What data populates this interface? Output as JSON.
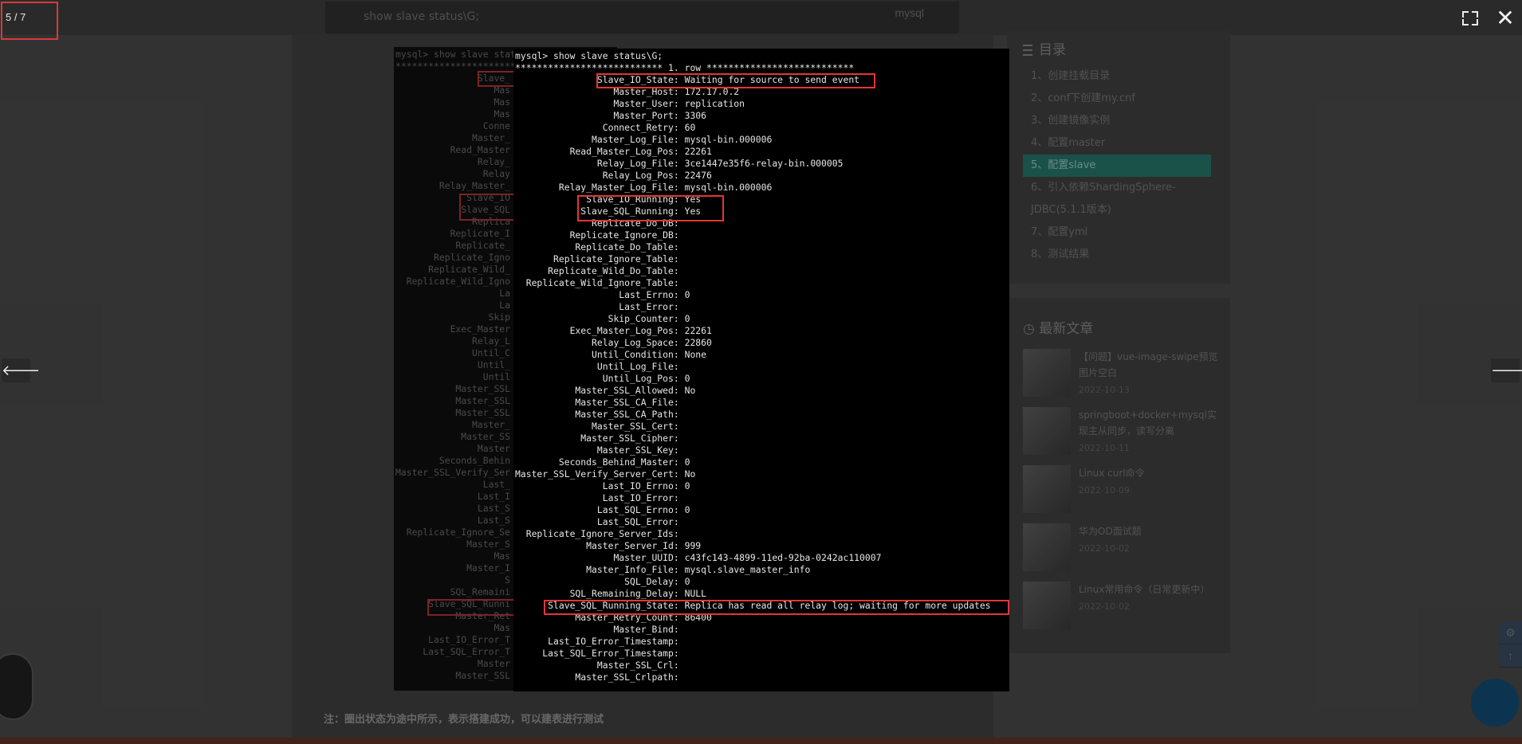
{
  "viewer": {
    "counter": "5 / 7",
    "close_label": "✕",
    "prev_label": "🡐",
    "next_label": "🡒"
  },
  "search": {
    "text": "show slave status\\G;",
    "tag": "mysql"
  },
  "toc": {
    "title": "目录",
    "items": [
      {
        "label": "1、创建挂载目录"
      },
      {
        "label": "2、conf下创建my.cnf"
      },
      {
        "label": "3、创建镜像实例"
      },
      {
        "label": "4、配置master"
      },
      {
        "label": "5、配置slave"
      },
      {
        "label": "6、引入依赖ShardingSphere-JDBC(5.1.1版本)"
      },
      {
        "label": "7、配置yml"
      },
      {
        "label": "8、测试结果"
      }
    ],
    "active_index": 4
  },
  "news": {
    "title": "最新文章",
    "items": [
      {
        "title": "【问题】vue-image-swipe预览图片空白",
        "date": "2022-10-13"
      },
      {
        "title": "springboot+docker+mysql实现主从同步，读写分离",
        "date": "2022-10-11"
      },
      {
        "title": "Linux curl命令",
        "date": "2022-10-09"
      },
      {
        "title": "华为OD面试题",
        "date": "2022-10-02"
      },
      {
        "title": "Linux常用命令（日常更新中）",
        "date": "2022-10-02"
      }
    ]
  },
  "article": {
    "note": "注：圈出状态为途中所示，表示搭建成功，可以建表进行测试"
  },
  "terminal": {
    "lines": [
      "mysql> show slave status\\G;",
      "*************************** 1. row ***************************",
      "               Slave_IO_State: Waiting for source to send event",
      "                  Master_Host: 172.17.0.2",
      "                  Master_User: replication",
      "                  Master_Port: 3306",
      "                Connect_Retry: 60",
      "              Master_Log_File: mysql-bin.000006",
      "          Read_Master_Log_Pos: 22261",
      "               Relay_Log_File: 3ce1447e35f6-relay-bin.000005",
      "                Relay_Log_Pos: 22476",
      "        Relay_Master_Log_File: mysql-bin.000006",
      "             Slave_IO_Running: Yes",
      "            Slave_SQL_Running: Yes",
      "              Replicate_Do_DB:",
      "          Replicate_Ignore_DB:",
      "           Replicate_Do_Table:",
      "       Replicate_Ignore_Table:",
      "      Replicate_Wild_Do_Table:",
      "  Replicate_Wild_Ignore_Table:",
      "                   Last_Errno: 0",
      "                   Last_Error:",
      "                 Skip_Counter: 0",
      "          Exec_Master_Log_Pos: 22261",
      "              Relay_Log_Space: 22860",
      "              Until_Condition: None",
      "               Until_Log_File:",
      "                Until_Log_Pos: 0",
      "           Master_SSL_Allowed: No",
      "           Master_SSL_CA_File:",
      "           Master_SSL_CA_Path:",
      "              Master_SSL_Cert:",
      "            Master_SSL_Cipher:",
      "               Master_SSL_Key:",
      "        Seconds_Behind_Master: 0",
      "Master_SSL_Verify_Server_Cert: No",
      "                Last_IO_Errno: 0",
      "                Last_IO_Error:",
      "               Last_SQL_Errno: 0",
      "               Last_SQL_Error:",
      "  Replicate_Ignore_Server_Ids:",
      "             Master_Server_Id: 999",
      "                  Master_UUID: c43fc143-4899-11ed-92ba-0242ac110007",
      "             Master_Info_File: mysql.slave_master_info",
      "                    SQL_Delay: 0",
      "          SQL_Remaining_Delay: NULL",
      "      Slave_SQL_Running_State: Replica has read all relay log; waiting for more updates",
      "           Master_Retry_Count: 86400",
      "                  Master_Bind:",
      "      Last_IO_Error_Timestamp:",
      "     Last_SQL_Error_Timestamp:",
      "               Master_SSL_Crl:",
      "           Master_SSL_Crlpath:"
    ]
  },
  "terminal_behind": {
    "lines": [
      "mysql> show slave stat",
      "*************************",
      "               Slave_",
      "                  Mas",
      "                  Mas",
      "                  Mas",
      "                Conne",
      "              Master_",
      "          Read_Master",
      "               Relay_",
      "                Relay",
      "        Relay_Master_",
      "             Slave_IO",
      "            Slave_SQL",
      "              Replica",
      "          Replicate_I",
      "           Replicate_",
      "       Replicate_Igno",
      "      Replicate_Wild_",
      "  Replicate_Wild_Igno",
      "                   La",
      "                   La",
      "                 Skip",
      "          Exec_Master",
      "              Relay_L",
      "              Until_C",
      "               Until_",
      "                Until",
      "           Master_SSL",
      "           Master_SSL",
      "           Master_SSL",
      "              Master_",
      "            Master_SS",
      "               Master",
      "        Seconds_Behin",
      "Master_SSL_Verify_Ser",
      "                Last_",
      "               Last_I",
      "               Last_S",
      "               Last_S",
      "  Replicate_Ignore_Se",
      "             Master_S",
      "                  Mas",
      "             Master_I",
      "                    S",
      "          SQL_Remaini",
      "      Slave_SQL_Runni",
      "           Master_Ret",
      "                  Mas",
      "      Last_IO_Error_T",
      "     Last_SQL_Error_T",
      "               Master",
      "           Master_SSL"
    ]
  },
  "colors": {
    "highlight": "#e53535",
    "toc_active": "#1e5e55"
  }
}
